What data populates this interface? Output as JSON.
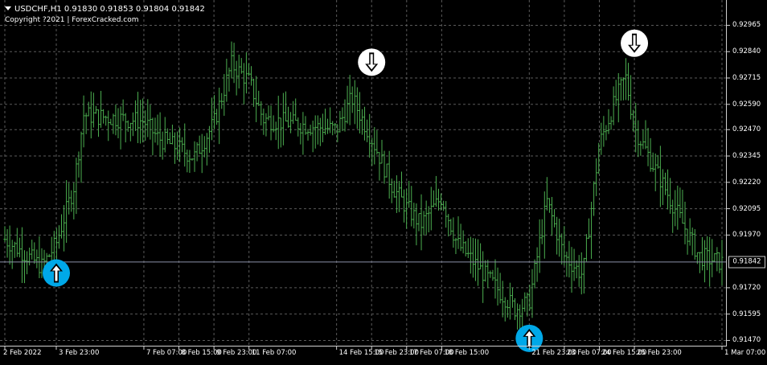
{
  "header": {
    "symbol_line": "USDCHF,H1  0.91830 0.91853 0.91804 0.91842",
    "copyright": "Copyright ?2021  |  ForexCracked.com",
    "dropdown_icon": "triangle-down-icon"
  },
  "colors": {
    "background": "#000000",
    "grid": "#5a5a5a",
    "bar": "#4caf50",
    "axis_text": "#ffffff",
    "current_price_line": "#8a8fa8",
    "buy_arrow": "#00a8e8",
    "sell_arrow": "#ffffff"
  },
  "price_axis": {
    "ticks": [
      "0.92965",
      "0.92840",
      "0.92715",
      "0.92590",
      "0.92470",
      "0.92345",
      "0.92220",
      "0.92095",
      "0.91970",
      "0.91720",
      "0.91595",
      "0.91470"
    ],
    "current_price": "0.91842"
  },
  "time_axis": {
    "labels": [
      "2 Feb 2022",
      "3 Feb 23:00",
      "7 Feb 07:00",
      "8 Feb 15:00",
      "9 Feb 23:00",
      "11 Feb 07:00",
      "14 Feb 15:00",
      "15 Feb 23:00",
      "17 Feb 07:00",
      "18 Feb 15:00",
      "21 Feb 23:00",
      "23 Feb 07:00",
      "24 Feb 15:00",
      "25 Feb 23:00",
      "1 Mar 07:00"
    ]
  },
  "chart_data": {
    "type": "bar",
    "symbol": "USDCHF",
    "timeframe": "H1",
    "ohlc_last": {
      "open": 0.9183,
      "high": 0.91853,
      "low": 0.91804,
      "close": 0.91842
    },
    "ylim": [
      0.91445,
      0.93085
    ],
    "series": [
      {
        "close_path": [
          [
            "2 Feb 2022",
            0.9195
          ],
          [
            "3 Feb 10:00",
            0.9182
          ],
          [
            "3 Feb 23:00",
            0.9193
          ],
          [
            "4 Feb 15:00",
            0.922
          ],
          [
            "5 Feb 00:00",
            0.9254
          ],
          [
            "7 Feb 07:00",
            0.9251
          ],
          [
            "7 Feb 20:00",
            0.9243
          ],
          [
            "8 Feb 15:00",
            0.9238
          ],
          [
            "9 Feb 05:00",
            0.9234
          ],
          [
            "9 Feb 23:00",
            0.925
          ],
          [
            "10 Feb 15:00",
            0.9278
          ],
          [
            "11 Feb 07:00",
            0.927
          ],
          [
            "11 Feb 20:00",
            0.9252
          ],
          [
            "14 Feb 15:00",
            0.9247
          ],
          [
            "15 Feb 05:00",
            0.9262
          ],
          [
            "15 Feb 23:00",
            0.9243
          ],
          [
            "16 Feb 18:00",
            0.922
          ],
          [
            "17 Feb 07:00",
            0.921
          ],
          [
            "17 Feb 20:00",
            0.9202
          ],
          [
            "18 Feb 15:00",
            0.9215
          ],
          [
            "19 Feb 05:00",
            0.9193
          ],
          [
            "21 Feb 10:00",
            0.9162
          ],
          [
            "21 Feb 23:00",
            0.9165
          ],
          [
            "22 Feb 15:00",
            0.9213
          ],
          [
            "23 Feb 07:00",
            0.9187
          ],
          [
            "24 Feb 00:00",
            0.9178
          ],
          [
            "24 Feb 15:00",
            0.924
          ],
          [
            "25 Feb 05:00",
            0.926
          ],
          [
            "25 Feb 15:00",
            0.9272
          ],
          [
            "25 Feb 23:00",
            0.9248
          ],
          [
            "28 Feb 10:00",
            0.9187
          ],
          [
            "1 Mar 07:00",
            0.9184
          ]
        ]
      }
    ],
    "signals": [
      {
        "type": "buy",
        "time": "3 Feb 23:00",
        "price": 0.9179
      },
      {
        "type": "sell",
        "time": "15 Feb 23:00",
        "price": 0.9279
      },
      {
        "type": "buy",
        "time": "21 Feb 23:00",
        "price": 0.9148
      },
      {
        "type": "sell",
        "time": "25 Feb 23:00",
        "price": 0.9288
      }
    ]
  }
}
